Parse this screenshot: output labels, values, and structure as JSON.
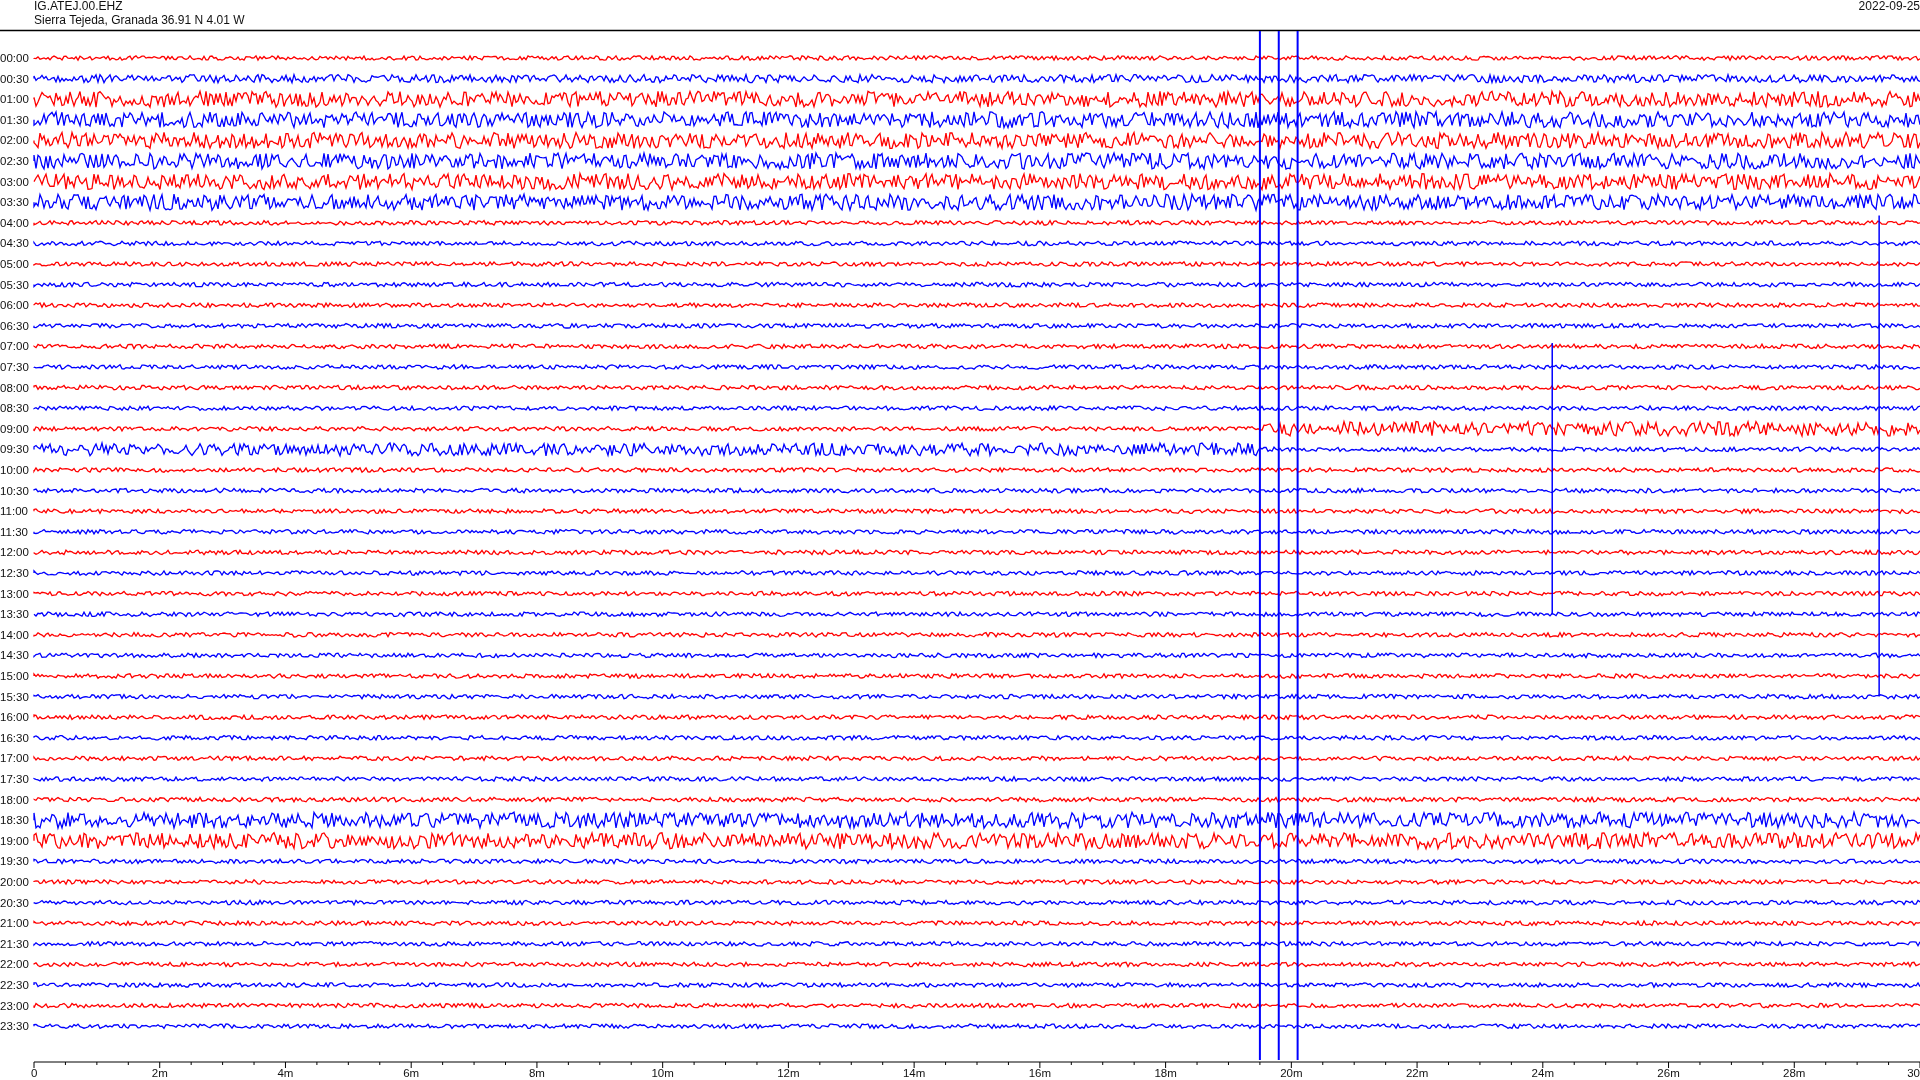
{
  "header": {
    "station": "IG.ATEJ.00.EHZ",
    "location": "Sierra Tejeda, Granada  36.91 N 4.01 W",
    "date": "2022-09-25"
  },
  "rows": [
    {
      "label": "00:00",
      "color": "#ff0000",
      "kind": "quiet"
    },
    {
      "label": "00:30",
      "color": "#0000ff",
      "kind": "medium"
    },
    {
      "label": "01:00",
      "color": "#ff0000",
      "kind": "noisy"
    },
    {
      "label": "01:30",
      "color": "#0000ff",
      "kind": "noisy"
    },
    {
      "label": "02:00",
      "color": "#ff0000",
      "kind": "noisy"
    },
    {
      "label": "02:30",
      "color": "#0000ff",
      "kind": "noisy"
    },
    {
      "label": "03:00",
      "color": "#ff0000",
      "kind": "noisy"
    },
    {
      "label": "03:30",
      "color": "#0000ff",
      "kind": "noisy"
    },
    {
      "label": "04:00",
      "color": "#ff0000",
      "kind": "quiet"
    },
    {
      "label": "04:30",
      "color": "#0000ff",
      "kind": "quiet"
    },
    {
      "label": "05:00",
      "color": "#ff0000",
      "kind": "quiet"
    },
    {
      "label": "05:30",
      "color": "#0000ff",
      "kind": "quiet"
    },
    {
      "label": "06:00",
      "color": "#ff0000",
      "kind": "quiet"
    },
    {
      "label": "06:30",
      "color": "#0000ff",
      "kind": "quiet"
    },
    {
      "label": "07:00",
      "color": "#ff0000",
      "kind": "quiet"
    },
    {
      "label": "07:30",
      "color": "#0000ff",
      "kind": "quiet"
    },
    {
      "label": "08:00",
      "color": "#ff0000",
      "kind": "quiet"
    },
    {
      "label": "08:30",
      "color": "#0000ff",
      "kind": "quiet"
    },
    {
      "label": "09:00",
      "color": "#ff0000",
      "kind": "noisy_late"
    },
    {
      "label": "09:30",
      "color": "#0000ff",
      "kind": "noisy_early"
    },
    {
      "label": "10:00",
      "color": "#ff0000",
      "kind": "quiet"
    },
    {
      "label": "10:30",
      "color": "#0000ff",
      "kind": "quiet"
    },
    {
      "label": "11:00",
      "color": "#ff0000",
      "kind": "quiet"
    },
    {
      "label": "11:30",
      "color": "#0000ff",
      "kind": "quiet"
    },
    {
      "label": "12:00",
      "color": "#ff0000",
      "kind": "quiet"
    },
    {
      "label": "12:30",
      "color": "#0000ff",
      "kind": "quiet"
    },
    {
      "label": "13:00",
      "color": "#ff0000",
      "kind": "quiet"
    },
    {
      "label": "13:30",
      "color": "#0000ff",
      "kind": "quiet"
    },
    {
      "label": "14:00",
      "color": "#ff0000",
      "kind": "quiet"
    },
    {
      "label": "14:30",
      "color": "#0000ff",
      "kind": "quiet"
    },
    {
      "label": "15:00",
      "color": "#ff0000",
      "kind": "quiet"
    },
    {
      "label": "15:30",
      "color": "#0000ff",
      "kind": "quiet"
    },
    {
      "label": "16:00",
      "color": "#ff0000",
      "kind": "quiet"
    },
    {
      "label": "16:30",
      "color": "#0000ff",
      "kind": "quiet"
    },
    {
      "label": "17:00",
      "color": "#ff0000",
      "kind": "quiet"
    },
    {
      "label": "17:30",
      "color": "#0000ff",
      "kind": "quiet"
    },
    {
      "label": "18:00",
      "color": "#ff0000",
      "kind": "quiet"
    },
    {
      "label": "18:30",
      "color": "#0000ff",
      "kind": "noisy"
    },
    {
      "label": "19:00",
      "color": "#ff0000",
      "kind": "noisy"
    },
    {
      "label": "19:30",
      "color": "#0000ff",
      "kind": "quiet"
    },
    {
      "label": "20:00",
      "color": "#ff0000",
      "kind": "quiet"
    },
    {
      "label": "20:30",
      "color": "#0000ff",
      "kind": "quiet"
    },
    {
      "label": "21:00",
      "color": "#ff0000",
      "kind": "quiet"
    },
    {
      "label": "21:30",
      "color": "#0000ff",
      "kind": "quiet"
    },
    {
      "label": "22:00",
      "color": "#ff0000",
      "kind": "quiet"
    },
    {
      "label": "22:30",
      "color": "#0000ff",
      "kind": "quiet"
    },
    {
      "label": "23:00",
      "color": "#ff0000",
      "kind": "quiet"
    },
    {
      "label": "23:30",
      "color": "#0000ff",
      "kind": "quiet"
    }
  ],
  "time_axis": {
    "ticks": [
      "0",
      "2m",
      "4m",
      "6m",
      "8m",
      "10m",
      "12m",
      "14m",
      "16m",
      "18m",
      "20m",
      "22m",
      "24m",
      "26m",
      "28m",
      "30"
    ]
  }
}
